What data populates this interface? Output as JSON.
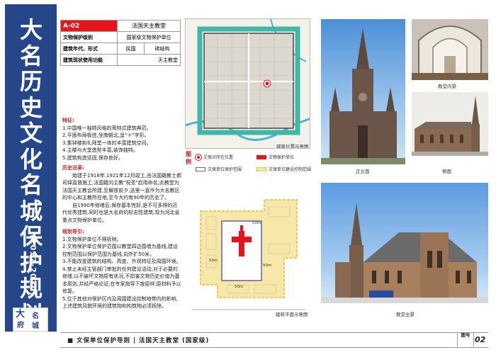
{
  "sidebar": {
    "title": "大名历史文化名城保护规划",
    "years": "(2012-2030)",
    "logo_text": "大名府城"
  },
  "info": {
    "code": "A-02",
    "name": "法国天主教堂",
    "rows": [
      {
        "label": "文物保护级别",
        "value": "国家级文物保护单位"
      },
      {
        "label": "建筑年代、形式",
        "value": "民国",
        "value2": "砖结构"
      },
      {
        "label": "建筑现状使用功能",
        "value": "天主教堂"
      }
    ]
  },
  "features": {
    "heading": "特征:",
    "items": [
      "1.中国唯一独特风格的哥特式建筑典范。",
      "2.平面布局极佳,坐南朝北,呈\"十\"字形。",
      "3.集钟楼和礼拜堂一体的丰富建筑空间。",
      "4.主楼与大堂造型丰富,装饰独特。",
      "5.建筑构造坚固,保存良好。"
    ]
  },
  "history": {
    "heading": "历史沿革:",
    "paragraphs": [
      "始建于1918年,1921年12月竣工,由法国籍教士郝司铎监督施工,法国籍刘主教\"祝圣\"启用命名,此教堂为法国天主教会所建,至解放前夕,这里一直作为大名教区的中心和主教所在地,至今大约有90年的历史了。",
      "自1990年修缮后,保存基本完好,是不可多得的近代优秀建筑,同时也是大名府的标志性建筑,现为河北省重点文物保护单位。"
    ]
  },
  "guide": {
    "heading": "规划导引:",
    "items": [
      "1.文物保护单位不得拆除。",
      "2.文物保护单位保护范围以教堂四边围墙为基线,建设控制范围以保护范围为基线,向外扩50米。",
      "3.不能改变建筑的结构、高度、外观特征及周围环境。",
      "4.禁止未经主管部门审批的任何建设活动,对于必要的修缮,以不破坏文物原有状况,不损害文物历史价值为基本原则,并经严格论证,在专家指导下按原样,原材料予以修复。",
      "5.位于其他对保护区内及周围建设控制地带内的影响,上述建筑风貌环境的建筑物和构筑物必须拆除。"
    ]
  },
  "captions": {
    "location_map": "建筑位置示意图",
    "plan_map": "建筑平面示意图",
    "interior": "教堂内景",
    "front": "正立面",
    "side": "侧面",
    "panorama": "教堂全景"
  },
  "legend": {
    "heading": "图例",
    "items": [
      {
        "label": "文保点所在位置",
        "color": "#e8141c"
      },
      {
        "label": "文物保护单位",
        "color": "#e8141c"
      },
      {
        "label": "文保单位保护范围",
        "color": "#6b5ca8"
      },
      {
        "label": "文保单位建设控制范围",
        "color": "#e6b93a"
      }
    ]
  },
  "plan_labels": [
    "50m",
    "50m",
    "50m",
    "50m"
  ],
  "footer": {
    "text": "■ 文保单位保护导则 | 法国天主教堂 (国家级)",
    "fig_label": "图号",
    "fig_num": "02"
  },
  "colors": {
    "sidebar": "#25478a",
    "accent": "#e8141c",
    "heading": "#b3231d"
  }
}
